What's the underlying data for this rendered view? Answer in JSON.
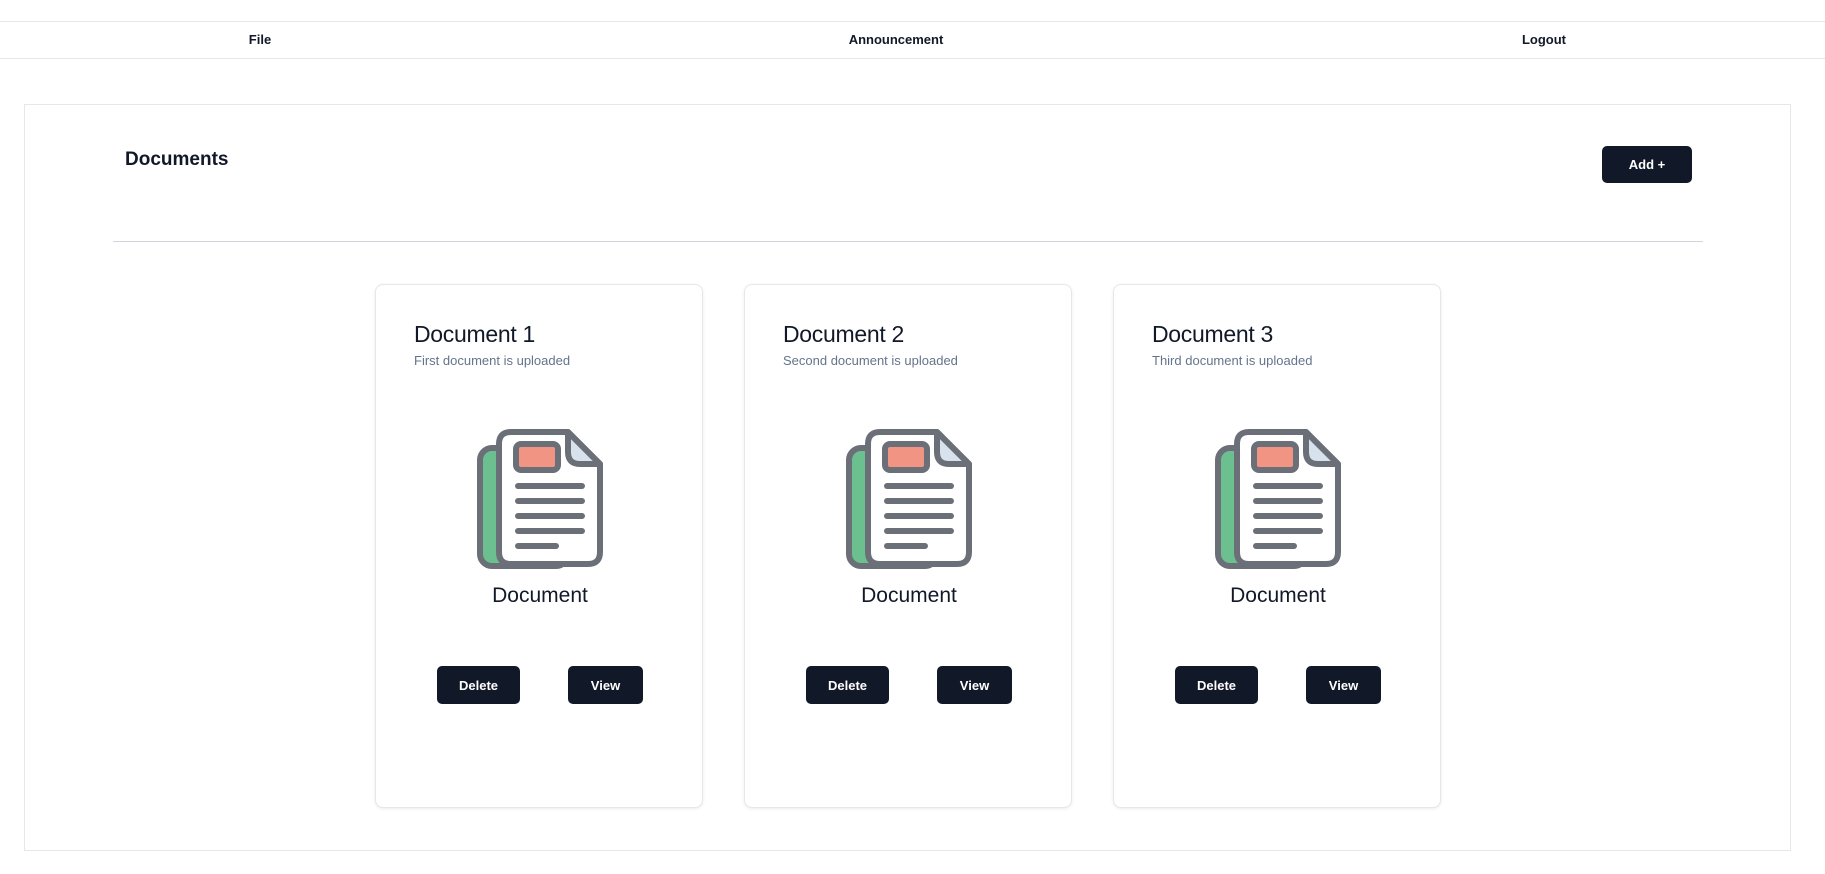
{
  "nav": {
    "items": [
      {
        "label": "File"
      },
      {
        "label": "Announcement"
      },
      {
        "label": "Logout"
      }
    ]
  },
  "page": {
    "title": "Documents",
    "add_button_label": "Add +"
  },
  "documents": [
    {
      "title": "Document 1",
      "subtitle": "First document is uploaded",
      "caption": "Document",
      "delete_label": "Delete",
      "view_label": "View"
    },
    {
      "title": "Document 2",
      "subtitle": "Second document is uploaded",
      "caption": "Document",
      "delete_label": "Delete",
      "view_label": "View"
    },
    {
      "title": "Document 3",
      "subtitle": "Third document is uploaded",
      "caption": "Document",
      "delete_label": "Delete",
      "view_label": "View"
    }
  ],
  "colors": {
    "button_bg": "#111827",
    "icon_stroke": "#6b6f78",
    "icon_back_sheet": "#6cbf8e",
    "icon_header_block": "#f19483",
    "icon_fold": "#d7e2ec"
  }
}
